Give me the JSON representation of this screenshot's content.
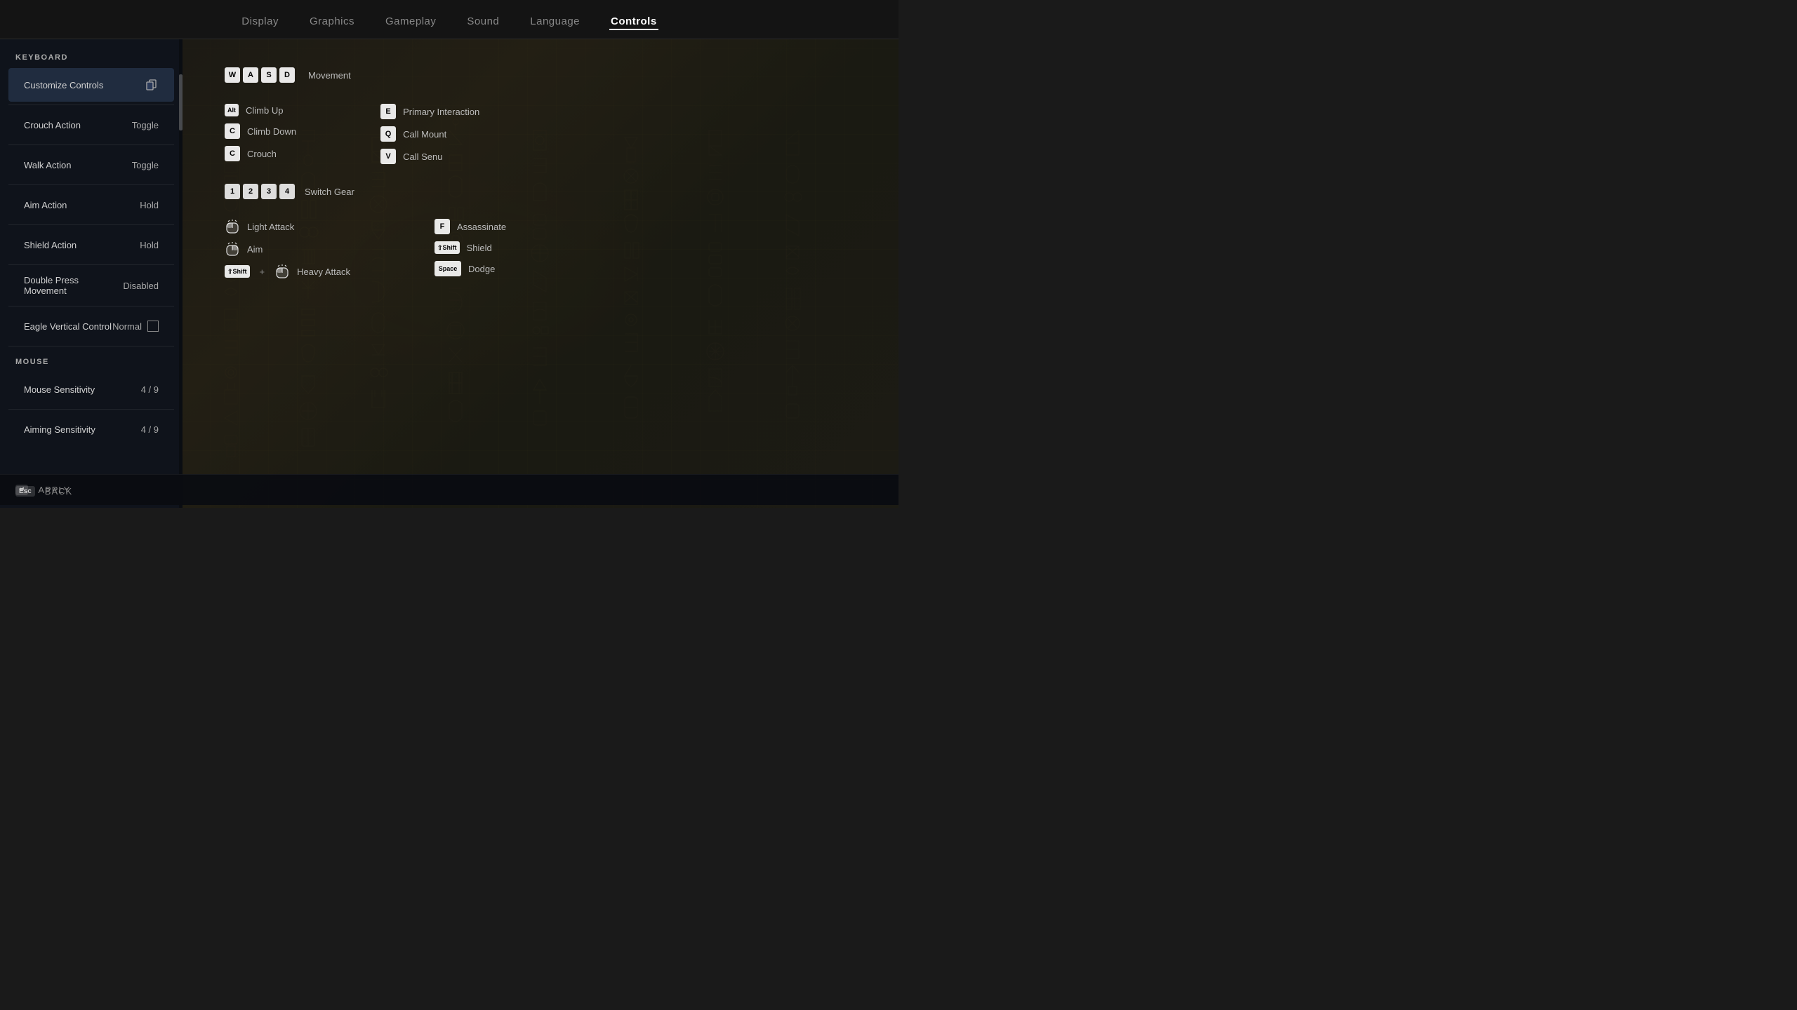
{
  "nav": {
    "items": [
      {
        "label": "Display",
        "active": false
      },
      {
        "label": "Graphics",
        "active": false
      },
      {
        "label": "Gameplay",
        "active": false
      },
      {
        "label": "Sound",
        "active": false
      },
      {
        "label": "Language",
        "active": false
      },
      {
        "label": "Controls",
        "active": true
      }
    ]
  },
  "sidebar": {
    "keyboard_label": "KEYBOARD",
    "mouse_label": "MOUSE",
    "items": [
      {
        "label": "Customize Controls",
        "value": "",
        "type": "header"
      },
      {
        "label": "Crouch Action",
        "value": "Toggle",
        "type": "setting"
      },
      {
        "label": "Walk Action",
        "value": "Toggle",
        "type": "setting"
      },
      {
        "label": "Aim Action",
        "value": "Hold",
        "type": "setting"
      },
      {
        "label": "Shield Action",
        "value": "Hold",
        "type": "setting"
      },
      {
        "label": "Double Press Movement",
        "value": "Disabled",
        "type": "setting"
      },
      {
        "label": "Eagle Vertical Control",
        "value": "Normal",
        "type": "setting-check"
      }
    ],
    "mouse_items": [
      {
        "label": "Mouse Sensitivity",
        "value": "4 / 9",
        "type": "setting"
      },
      {
        "label": "Aiming Sensitivity",
        "value": "4 / 9",
        "type": "setting"
      }
    ]
  },
  "keybinds": {
    "movement_label": "Movement",
    "wasd_keys": [
      "W",
      "A",
      "S",
      "D"
    ],
    "movement_section": [
      {
        "key": "Alt",
        "label": "Climb Up"
      },
      {
        "key": "C",
        "label": "Climb Down"
      },
      {
        "key": "C",
        "label": "Crouch"
      }
    ],
    "movement_right": [
      {
        "key": "E",
        "label": "Primary Interaction"
      },
      {
        "key": "Q",
        "label": "Call Mount"
      },
      {
        "key": "V",
        "label": "Call Senu"
      }
    ],
    "switch_gear": {
      "keys": [
        "1",
        "2",
        "3",
        "4"
      ],
      "label": "Switch Gear"
    },
    "combat_left": [
      {
        "key": "mouse_left",
        "label": "Light Attack",
        "type": "mouse"
      },
      {
        "key": "mouse_right",
        "label": "Aim",
        "type": "mouse"
      },
      {
        "key": "shift_mouse",
        "label": "Heavy Attack",
        "type": "mouse_combo"
      }
    ],
    "combat_right": [
      {
        "key": "F",
        "label": "Assassinate"
      },
      {
        "key": "Shift",
        "label": "Shield"
      },
      {
        "key": "Space",
        "label": "Dodge"
      }
    ]
  },
  "bottom": {
    "apply_label": "APPLY",
    "back_label": "BACK"
  }
}
